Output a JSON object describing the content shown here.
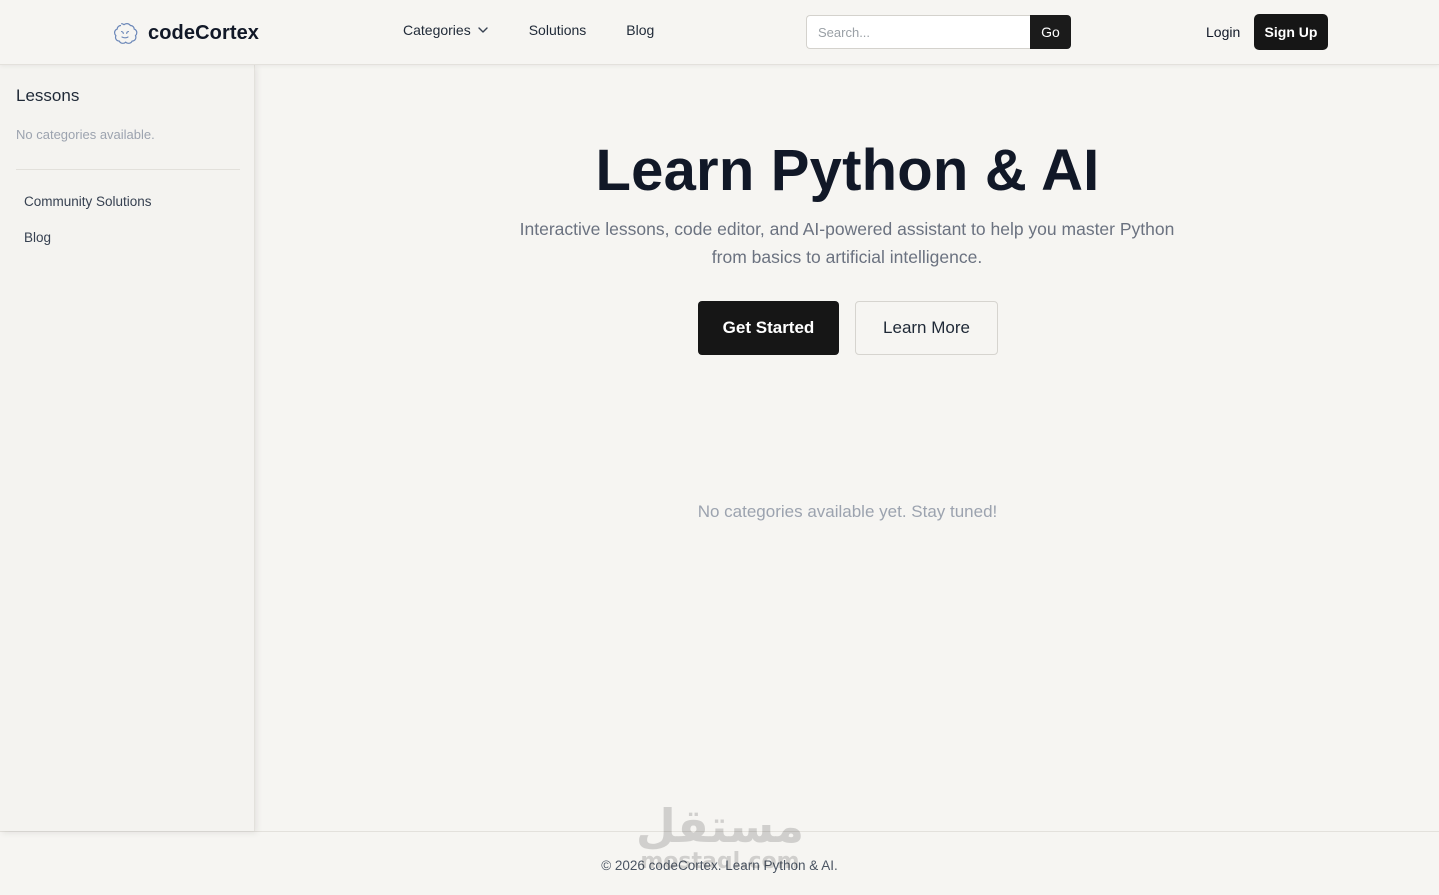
{
  "header": {
    "brand": "codeCortex",
    "nav": {
      "categories": "Categories",
      "solutions": "Solutions",
      "blog": "Blog"
    },
    "search": {
      "placeholder": "Search...",
      "button": "Go"
    },
    "login": "Login",
    "signup": "Sign Up"
  },
  "sidebar": {
    "title": "Lessons",
    "empty": "No categories available.",
    "links": [
      "Community Solutions",
      "Blog"
    ]
  },
  "hero": {
    "title": "Learn Python & AI",
    "subtitle_line1": "Interactive lessons, code editor, and AI-powered assistant to help you master Python",
    "subtitle_line2": "from basics to artificial intelligence.",
    "primary_button": "Get Started",
    "secondary_button": "Learn More"
  },
  "main": {
    "empty_state": "No categories available yet. Stay tuned!"
  },
  "footer": {
    "text": "© 2026 codeCortex. Learn Python & AI."
  },
  "watermark": {
    "arabic": "مستقل",
    "latin": "mostaql.com"
  },
  "colors": {
    "background": "#f6f5f2",
    "dark_button": "#161616",
    "muted_text": "#9ca3af"
  },
  "icons": {
    "brand": "brain-icon",
    "categories": "chevron-down-icon"
  }
}
